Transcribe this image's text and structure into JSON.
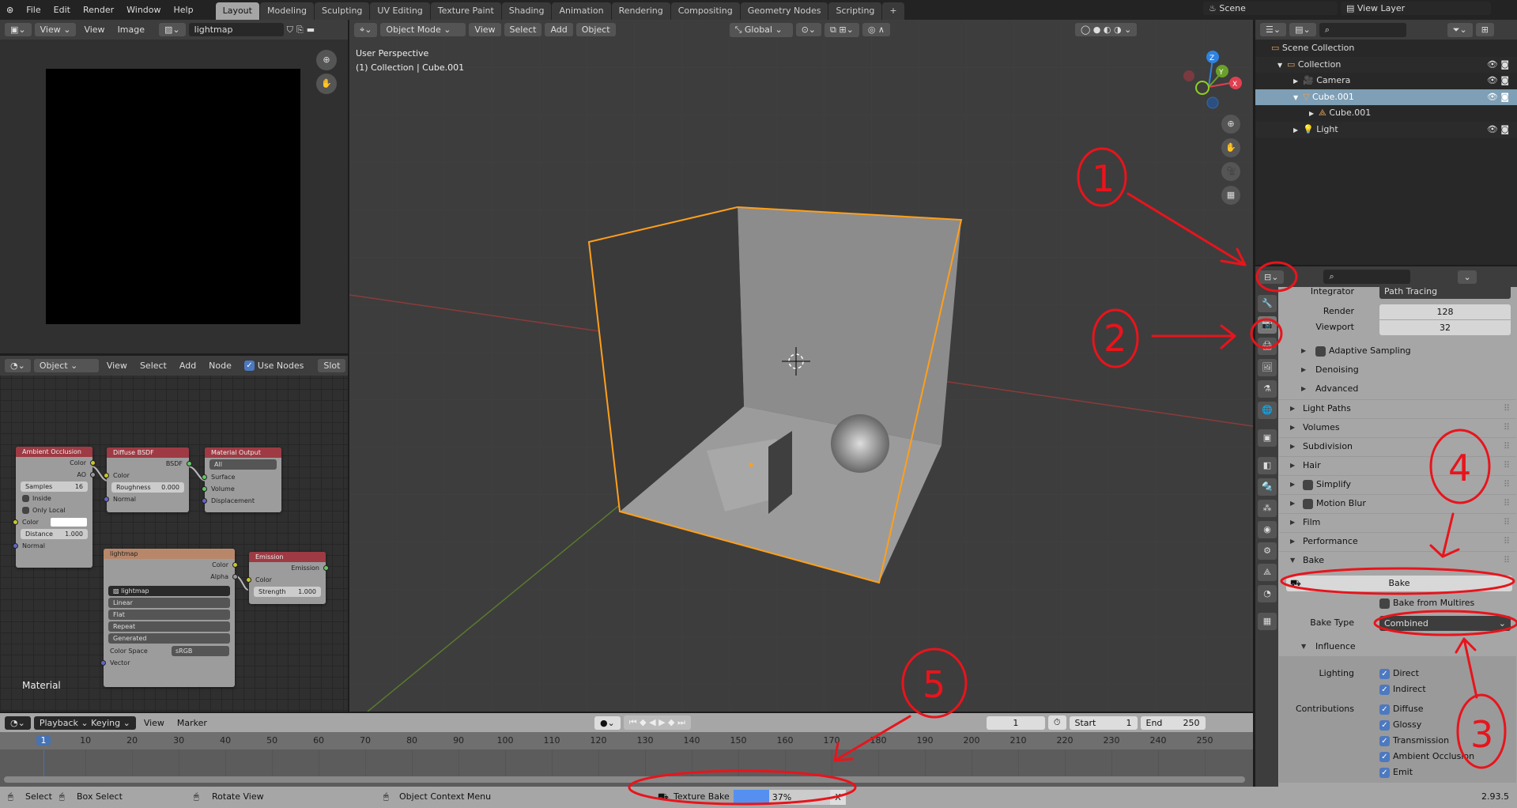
{
  "topbar": {
    "menus": [
      "File",
      "Edit",
      "Render",
      "Window",
      "Help"
    ],
    "workspaces": [
      "Layout",
      "Modeling",
      "Sculpting",
      "UV Editing",
      "Texture Paint",
      "Shading",
      "Animation",
      "Rendering",
      "Compositing",
      "Geometry Nodes",
      "Scripting",
      "+"
    ],
    "active_workspace": "Layout",
    "scene": "Scene",
    "view_layer": "View Layer"
  },
  "image_editor": {
    "view_btn": "View",
    "menus": [
      "View",
      "Image"
    ],
    "image_name": "lightmap"
  },
  "node_editor": {
    "object_btn": "Object",
    "menus": [
      "View",
      "Select",
      "Add",
      "Node"
    ],
    "use_nodes": "Use Nodes",
    "slot": "Slot",
    "label": "Material",
    "nodes": {
      "ao": {
        "title": "Ambient Occlusion",
        "out_color": "Color",
        "out_ao": "AO",
        "samples_label": "Samples",
        "samples": "16",
        "inside": "Inside",
        "only_local": "Only Local",
        "color": "Color",
        "distance_label": "Distance",
        "distance": "1.000",
        "normal": "Normal"
      },
      "diffuse": {
        "title": "Diffuse BSDF",
        "out": "BSDF",
        "color": "Color",
        "roughness_label": "Roughness",
        "roughness": "0.000",
        "normal": "Normal"
      },
      "output": {
        "title": "Material Output",
        "target": "All",
        "surface": "Surface",
        "volume": "Volume",
        "displacement": "Displacement"
      },
      "lightmap": {
        "title": "lightmap",
        "out_color": "Color",
        "out_alpha": "Alpha",
        "image": "lightmap",
        "interp": "Linear",
        "proj": "Flat",
        "ext": "Repeat",
        "source": "Generated",
        "cs_label": "Color Space",
        "cs": "sRGB",
        "vector": "Vector"
      },
      "emission": {
        "title": "Emission",
        "out": "Emission",
        "color": "Color",
        "strength_label": "Strength",
        "strength": "1.000"
      }
    }
  },
  "viewport": {
    "mode": "Object Mode",
    "menus": [
      "View",
      "Select",
      "Add",
      "Object"
    ],
    "orientation": "Global",
    "title": "User Perspective",
    "subtitle": "(1) Collection | Cube.001",
    "gizmo": {
      "x": "X",
      "y": "Y",
      "z": "Z"
    }
  },
  "outliner": {
    "items": [
      {
        "label": "Scene Collection",
        "indent": 0
      },
      {
        "label": "Collection",
        "indent": 1
      },
      {
        "label": "Camera",
        "indent": 2
      },
      {
        "label": "Cube.001",
        "indent": 2,
        "selected": true
      },
      {
        "label": "Cube.001",
        "indent": 3
      },
      {
        "label": "Light",
        "indent": 2
      }
    ]
  },
  "properties": {
    "integrator_label": "Integrator",
    "integrator": "Path Tracing",
    "render_label": "Render",
    "render": "128",
    "viewport_label": "Viewport",
    "viewport": "32",
    "subpanels": [
      "Adaptive Sampling",
      "Denoising",
      "Advanced"
    ],
    "panels": [
      "Light Paths",
      "Volumes",
      "Subdivision",
      "Hair",
      "Simplify",
      "Motion Blur",
      "Film",
      "Performance",
      "Bake"
    ],
    "bake_button": "Bake",
    "bake_from_multires": "Bake from Multires",
    "bake_type_label": "Bake Type",
    "bake_type": "Combined",
    "influence": "Influence",
    "lighting_label": "Lighting",
    "lighting": [
      "Direct",
      "Indirect"
    ],
    "contributions_label": "Contributions",
    "contributions": [
      "Diffuse",
      "Glossy",
      "Transmission",
      "Ambient Occlusion",
      "Emit"
    ]
  },
  "timeline": {
    "menus": [
      "Playback",
      "Keying",
      "View",
      "Marker"
    ],
    "current_frame": "1",
    "start_label": "Start",
    "start": "1",
    "end_label": "End",
    "end": "250",
    "ticks": [
      1,
      10,
      20,
      30,
      40,
      50,
      60,
      70,
      80,
      90,
      100,
      110,
      120,
      130,
      140,
      150,
      160,
      170,
      180,
      190,
      200,
      210,
      220,
      230,
      240,
      250
    ]
  },
  "statusbar": {
    "select": "Select",
    "box_select": "Box Select",
    "rotate": "Rotate View",
    "context": "Object Context Menu",
    "job": "Texture Bake",
    "progress_text": "37%",
    "progress": 0.37,
    "cancel": "X",
    "version": "2.93.5"
  },
  "annotations": {
    "numbers": [
      "1",
      "2",
      "3",
      "4",
      "5"
    ],
    "color": "#e8141c"
  },
  "colors": {
    "accent": "#4772b3",
    "selection": "#ff9f1a",
    "annotation": "#e8141c"
  }
}
